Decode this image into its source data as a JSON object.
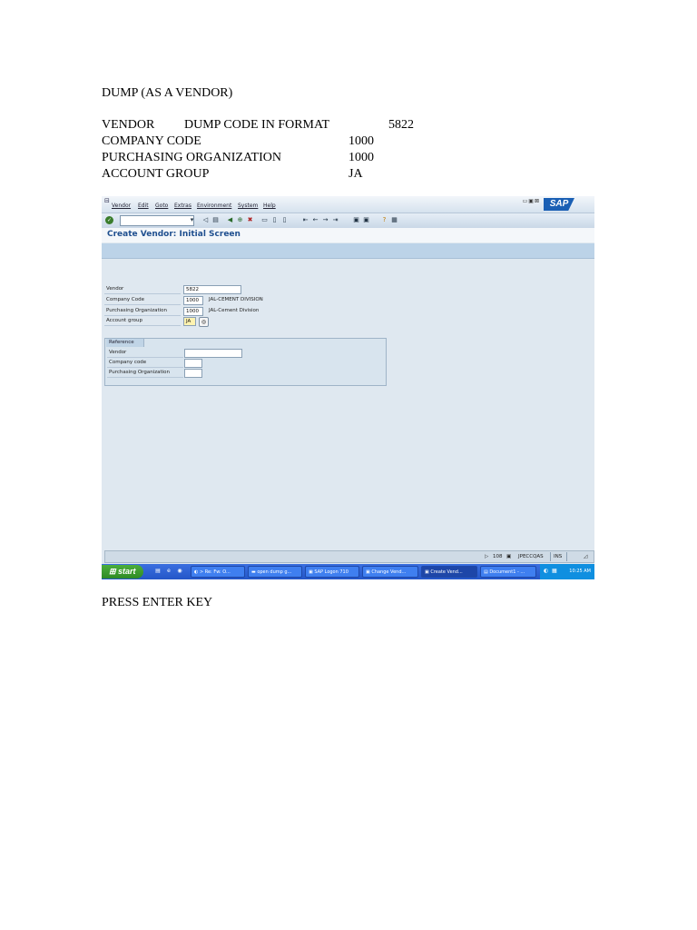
{
  "doc": {
    "title": "DUMP (AS A VENDOR)",
    "rows": [
      {
        "label": "VENDOR",
        "mid": "DUMP CODE IN FORMAT",
        "value": "5822"
      },
      {
        "label": "COMPANY CODE",
        "mid": "",
        "value": "1000"
      },
      {
        "label": "PURCHASING ORGANIZATION",
        "mid": "",
        "value": "1000"
      },
      {
        "label": "ACCOUNT GROUP",
        "mid": "",
        "value": "JA"
      }
    ],
    "footer": "PRESS ENTER KEY"
  },
  "sap": {
    "menu": [
      "Vendor",
      "Edit",
      "Goto",
      "Extras",
      "Environment",
      "System",
      "Help"
    ],
    "logo": "SAP",
    "screen_title": "Create Vendor:  Initial Screen",
    "fields": [
      {
        "label": "Vendor",
        "value": "5822",
        "desc": ""
      },
      {
        "label": "Company Code",
        "value": "1000",
        "desc": "JAL-CEMENT DIVISION"
      },
      {
        "label": "Purchasing Organization",
        "value": "1000",
        "desc": "JAL-Cement Division"
      },
      {
        "label": "Account group",
        "value": "JA",
        "desc": ""
      }
    ],
    "reference": {
      "tab": "Reference",
      "fields": [
        {
          "label": "Vendor",
          "value": ""
        },
        {
          "label": "Company code",
          "value": ""
        },
        {
          "label": "Purchasing Organization",
          "value": ""
        }
      ]
    },
    "status": {
      "session": "108",
      "server": "JPECCQAS",
      "mode": "INS"
    }
  },
  "taskbar": {
    "start": "start",
    "tasks": [
      "> Re: Fw: O...",
      "open dump g...",
      "SAP Logon 710",
      "Change Vend...",
      "Create Vend...",
      "Document1 - ..."
    ],
    "clock": "10:25 AM"
  },
  "colors": {
    "sap_blue": "#1f4f8f",
    "taskbar_blue": "#2456c8",
    "start_green": "#3a9a2e",
    "required_yellow": "#fff3b0"
  }
}
